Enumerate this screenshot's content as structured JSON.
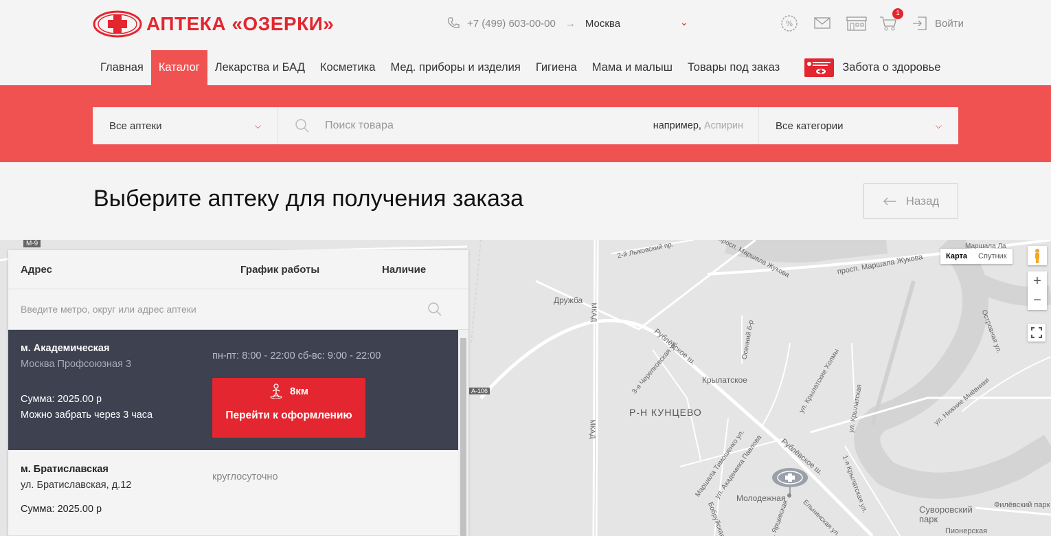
{
  "brand": {
    "name": "АПТЕКА «ОЗЕРКИ»",
    "accent": "#e3262f",
    "band_color": "#f05252"
  },
  "header": {
    "phone": "+7 (499) 603-00-00",
    "city": "Москва",
    "cart_count": "1",
    "login_label": "Войти",
    "icons": [
      "discount-icon",
      "mail-icon",
      "store-icon",
      "cart-icon",
      "login-icon"
    ]
  },
  "nav": {
    "items": [
      "Главная",
      "Каталог",
      "Лекарства и БАД",
      "Косметика",
      "Мед. приборы и изделия",
      "Гигиена",
      "Мама и малыш",
      "Товары под заказ"
    ],
    "active": "Каталог",
    "care_label": "Забота о здоровье"
  },
  "search": {
    "pharmacy_select": "Все аптеки",
    "placeholder": "Поиск товара",
    "example_prefix": "например,",
    "example_value": "Аспирин",
    "category_select": "Все категории"
  },
  "page": {
    "title": "Выберите аптеку для получения заказа",
    "back_label": "Назад"
  },
  "panel": {
    "col_address": "Адрес",
    "col_schedule": "График работы",
    "col_availability": "Наличие",
    "search_placeholder": "Введите метро, округ или адрес аптеки",
    "pharmacies": [
      {
        "metro": "м. Академическая",
        "address": "Москва Профсоюзная 3",
        "hours": "пн-пт: 8:00 - 22:00 сб-вс: 9:00 - 22:00",
        "sum": "Сумма: 2025.00 р",
        "pickup": "Можно забрать через 3 часа",
        "distance": "8км",
        "action": "Перейти к оформлению"
      },
      {
        "metro": "м. Братиславская",
        "address": "ул. Братиславская, д.12",
        "hours": "круглосуточно",
        "sum": "Сумма: 2025.00 р"
      }
    ]
  },
  "map": {
    "type_map": "Карта",
    "type_satellite": "Спутник",
    "zoom_in": "+",
    "zoom_out": "−",
    "labels": {
      "m9": "М-9",
      "lykovsky": "2-й Лыковский пр.",
      "marshal_zhukov": "просп. Маршала Жукова",
      "marshal_zhukov2": "просп. Маршала Жукова",
      "marshala_la": "Маршала Ла",
      "druzhba": "Дружба",
      "mkad": "МКАД",
      "mkad2": "МКАД",
      "rublevskoe": "Рублёвское ш.",
      "rublevskoe2": "Рублёвское ш.",
      "krylatskoe": "Крылатское",
      "kuntsevo": "Р-Н КУНЦЕВО",
      "a106": "А-106",
      "molodezhnaya": "Молодежная",
      "suvorovsky": "Суворовский парк",
      "filevsky": "Филёвский парк",
      "pionerskaya": "Пионерская",
      "ostrovnaya": "Островная ул.",
      "nizhnie": "ул. Нижние Мнёвники",
      "krylatskie": "ул. Крылатские Холмы",
      "cherepkovskaya": "3-я Черепковская ул.",
      "osenniy": "Осенний б-р",
      "timoshenko": "Маршала Тимошенко ул.",
      "pavlova": "ул. Академика Павлова",
      "krylatskaya1": "1-я Крылатская ул.",
      "elninskaya": "Ельнинская ул.",
      "bobruysk": "Бобруйская ул.",
      "yartsevskaya": "ул. Ярцевская",
      "krylatskaya": "ул. Крылатская"
    }
  }
}
